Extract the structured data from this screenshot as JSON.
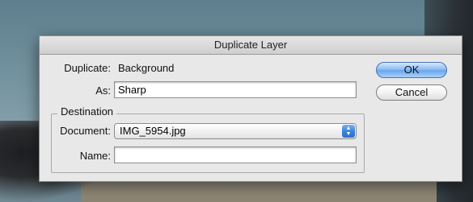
{
  "dialog": {
    "title": "Duplicate Layer",
    "duplicate_label": "Duplicate:",
    "duplicate_value": "Background",
    "as_label": "As:",
    "as_value": "Sharp",
    "destination": {
      "title": "Destination",
      "document_label": "Document:",
      "document_value": "IMG_5954.jpg",
      "name_label": "Name:",
      "name_value": ""
    },
    "buttons": {
      "ok": "OK",
      "cancel": "Cancel"
    }
  },
  "colors": {
    "default_button": "#6aa6ec",
    "stepper": "#3d83d9"
  }
}
